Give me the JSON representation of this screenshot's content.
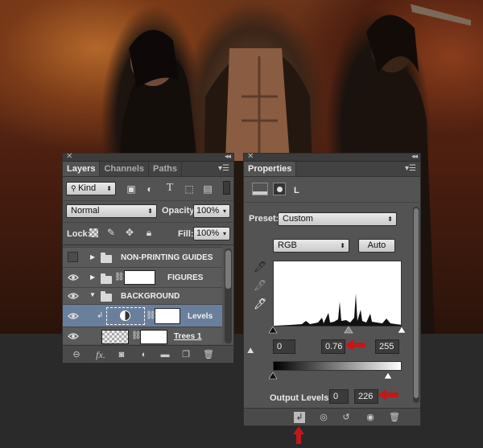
{
  "layers_panel": {
    "tabs": [
      {
        "label": "Layers",
        "active": true
      },
      {
        "label": "Channels",
        "active": false
      },
      {
        "label": "Paths",
        "active": false
      }
    ],
    "filter": {
      "value": "Kind"
    },
    "blend_mode": {
      "value": "Normal"
    },
    "opacity": {
      "label": "Opacity:",
      "value": "100%"
    },
    "lock": {
      "label": "Lock:"
    },
    "fill": {
      "label": "Fill:",
      "value": "100%"
    },
    "layers": [
      {
        "name": "NON-PRINTING GUIDES",
        "visible": false,
        "type": "group"
      },
      {
        "name": "FIGURES",
        "visible": true,
        "type": "group-masked"
      },
      {
        "name": "BACKGROUND",
        "visible": true,
        "type": "group-open"
      },
      {
        "name": "Levels",
        "visible": true,
        "type": "adjustment",
        "selected": true
      },
      {
        "name": "Trees 1",
        "visible": true,
        "type": "pixel"
      }
    ],
    "footer_icons": [
      "link-icon",
      "fx-icon",
      "mask-icon",
      "adjustment-icon",
      "group-icon",
      "new-layer-icon",
      "trash-icon"
    ],
    "footer_fx": "fx."
  },
  "properties_panel": {
    "tab": "Properties",
    "header_icon_label": "L",
    "preset": {
      "label": "Preset:",
      "value": "Custom"
    },
    "channel": {
      "value": "RGB"
    },
    "auto_button": "Auto",
    "input_levels": {
      "black": "0",
      "gamma": "0.76",
      "white": "255"
    },
    "output_levels": {
      "label": "Output Levels:",
      "black": "0",
      "white": "226"
    },
    "footer_icons": [
      "clip-icon",
      "view-previous-icon",
      "reset-icon",
      "visibility-icon",
      "trash-icon"
    ]
  },
  "colors": {
    "annotation_arrow": "#c0181b",
    "panel_bg": "#535353",
    "selected_layer": "#6a7f9b"
  }
}
